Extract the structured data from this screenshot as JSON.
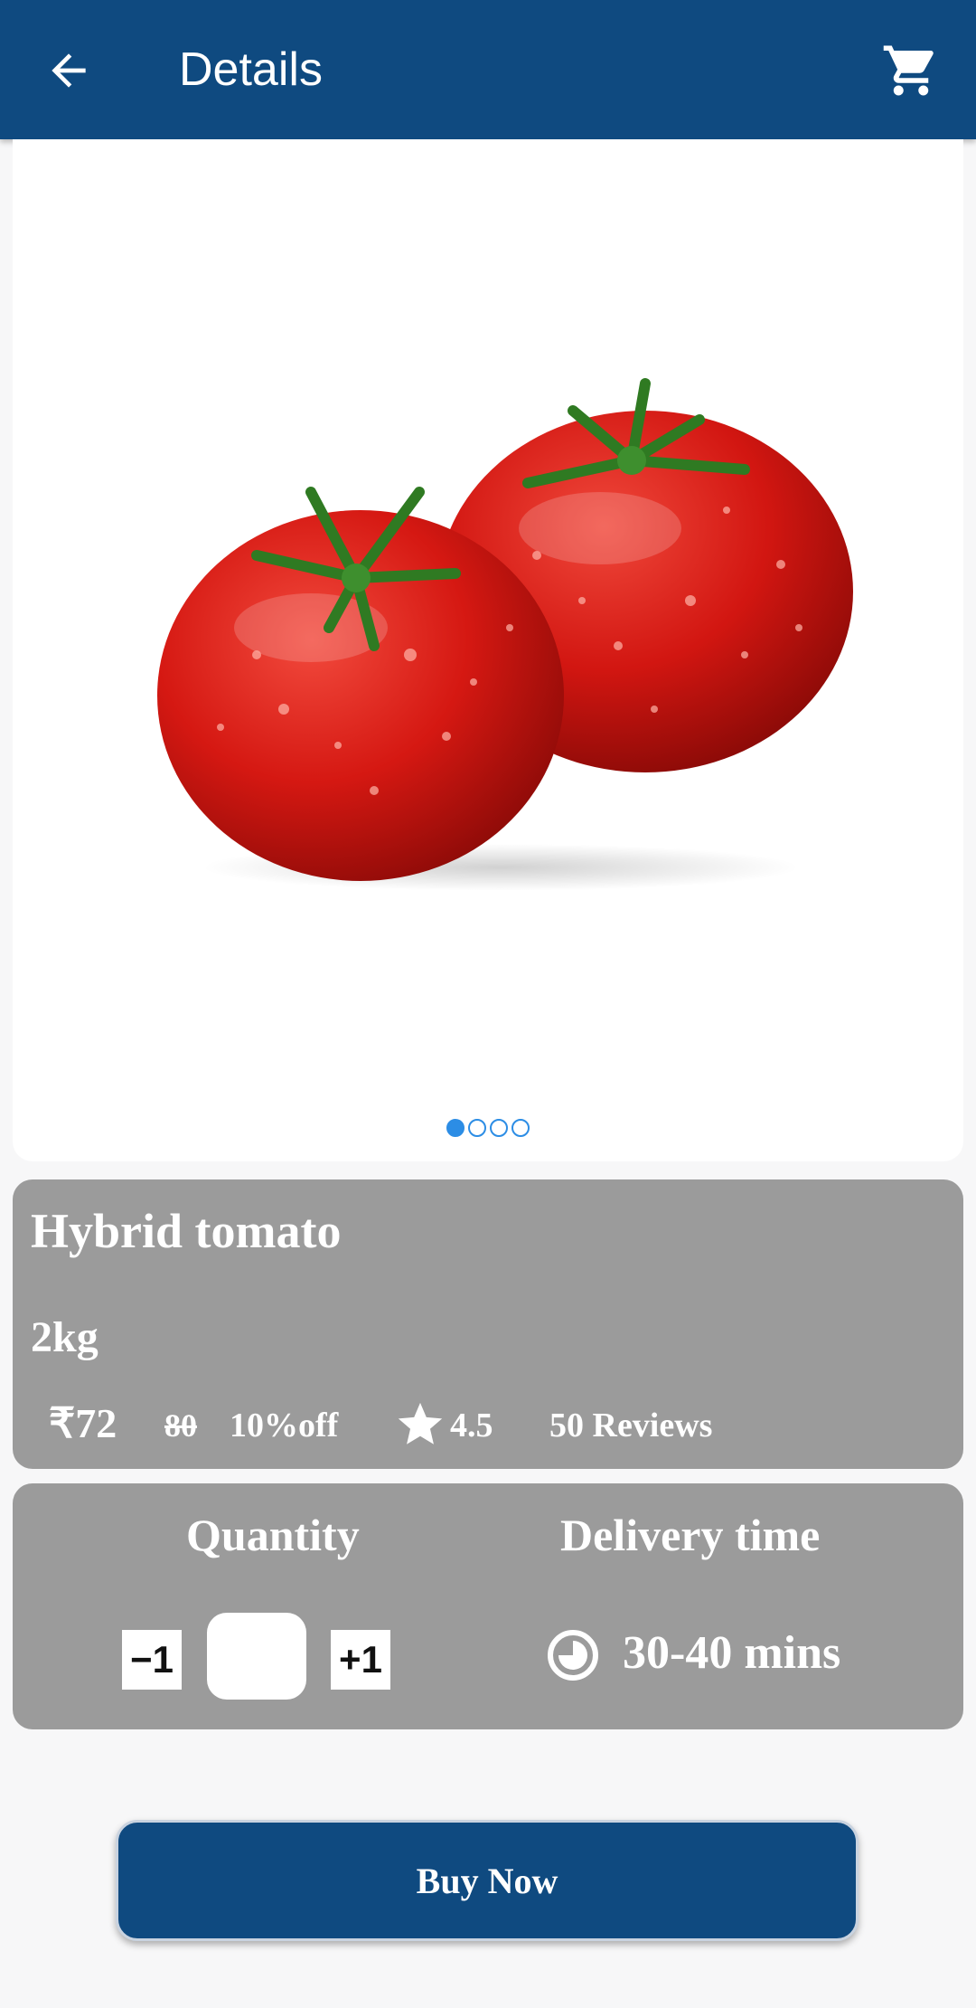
{
  "app_bar": {
    "title": "Details",
    "back_icon": "arrow-back-icon",
    "cart_icon": "shopping-cart-icon",
    "background_color": "#0f4a80"
  },
  "carousel": {
    "image_description": "two-tomatoes-image",
    "page_count": 4,
    "active_index": 0,
    "indicator_color": "#2c8de5"
  },
  "product": {
    "name": "Hybrid tomato",
    "weight": "2kg",
    "price": "₹72",
    "original_price": "80",
    "discount": "10%off",
    "rating_icon": "star-icon",
    "rating": "4.5",
    "reviews": "50 Reviews"
  },
  "order": {
    "quantity_label": "Quantity",
    "decrement_label": "−1",
    "increment_label": "+1",
    "quantity_value": "",
    "delivery_label": "Delivery time",
    "delivery_icon": "clock-icon",
    "delivery_time": "30-40 mins"
  },
  "buy_button": {
    "label": "Buy Now",
    "color": "#0f4a80"
  }
}
